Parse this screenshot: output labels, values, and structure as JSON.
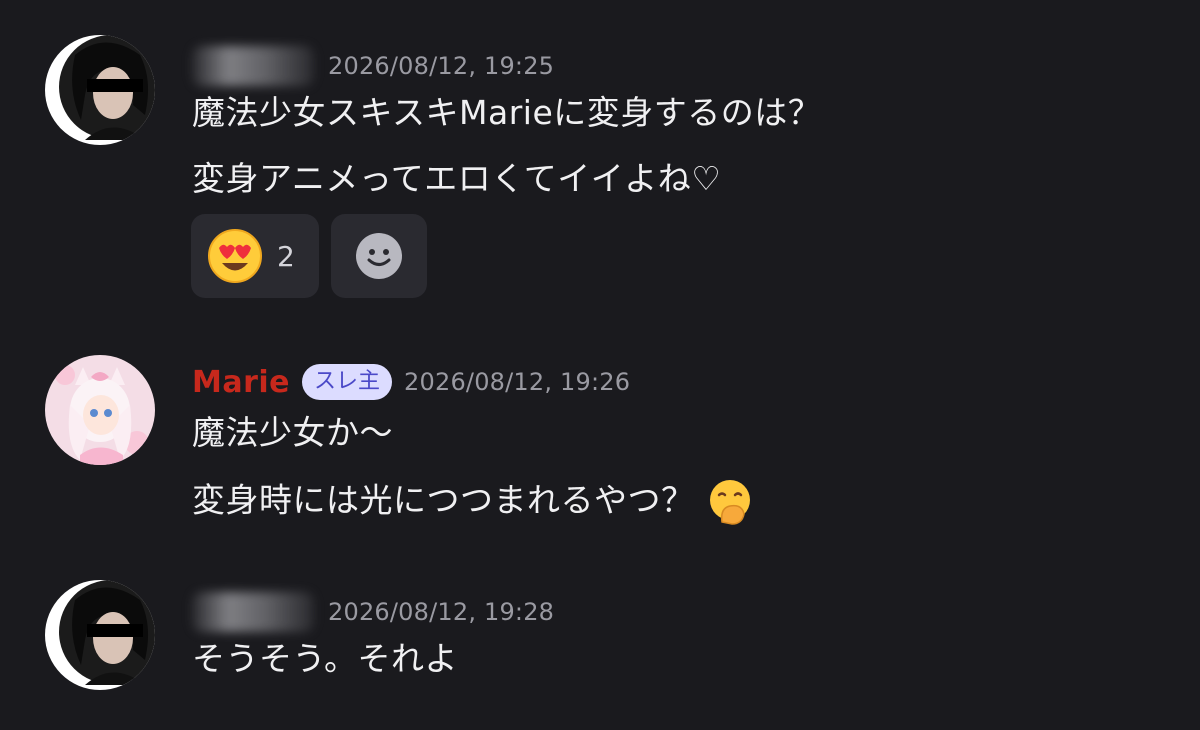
{
  "messages": [
    {
      "author": "こたや",
      "author_blurred": true,
      "timestamp": "2026/08/12, 19:25",
      "lines": [
        "魔法少女スキスキMarieに変身するのは？",
        "変身アニメってエロくてイイよね♡"
      ],
      "reactions": [
        {
          "emoji": "heart-eyes-emoji",
          "count": "2"
        }
      ],
      "add_reaction_icon": "add-reaction-icon"
    },
    {
      "author": "Marie",
      "author_color": "#c7281c",
      "badge": "スレ主",
      "timestamp": "2026/08/12, 19:26",
      "lines": [
        "魔法少女か～",
        "変身時には光につつまれるやつ？"
      ],
      "trailing_emoji": "hand-over-mouth-emoji"
    },
    {
      "author": "こたや",
      "author_blurred": true,
      "timestamp": "2026/08/12, 19:28",
      "lines": [
        "そうそう。それよ"
      ]
    }
  ],
  "colors": {
    "background": "#1a1a1e",
    "timestamp": "#9a9aa2",
    "badge_bg": "#dcdcff",
    "badge_text": "#4b49c8",
    "reaction_bg": "#2a2a30"
  }
}
